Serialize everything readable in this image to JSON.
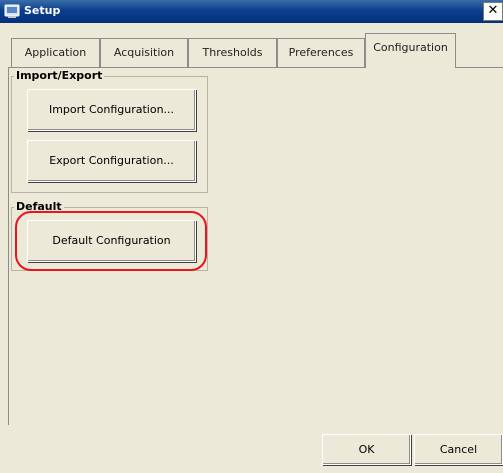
{
  "window": {
    "title": "Setup"
  },
  "tabs": [
    {
      "label": "Application"
    },
    {
      "label": "Acquisition"
    },
    {
      "label": "Thresholds"
    },
    {
      "label": "Preferences"
    },
    {
      "label": "Configuration"
    }
  ],
  "active_tab": "Configuration",
  "import_export": {
    "legend": "Import/Export",
    "import_label": "Import Configuration...",
    "export_label": "Export Configuration..."
  },
  "default": {
    "legend": "Default",
    "default_label": "Default Configuration"
  },
  "footer": {
    "ok_label": "OK",
    "cancel_label": "Cancel"
  },
  "colors": {
    "highlight": "#e8151d",
    "titlebar": "#0b3f8f"
  },
  "icons": {
    "app": "setup-app-icon",
    "close": "close-icon"
  }
}
